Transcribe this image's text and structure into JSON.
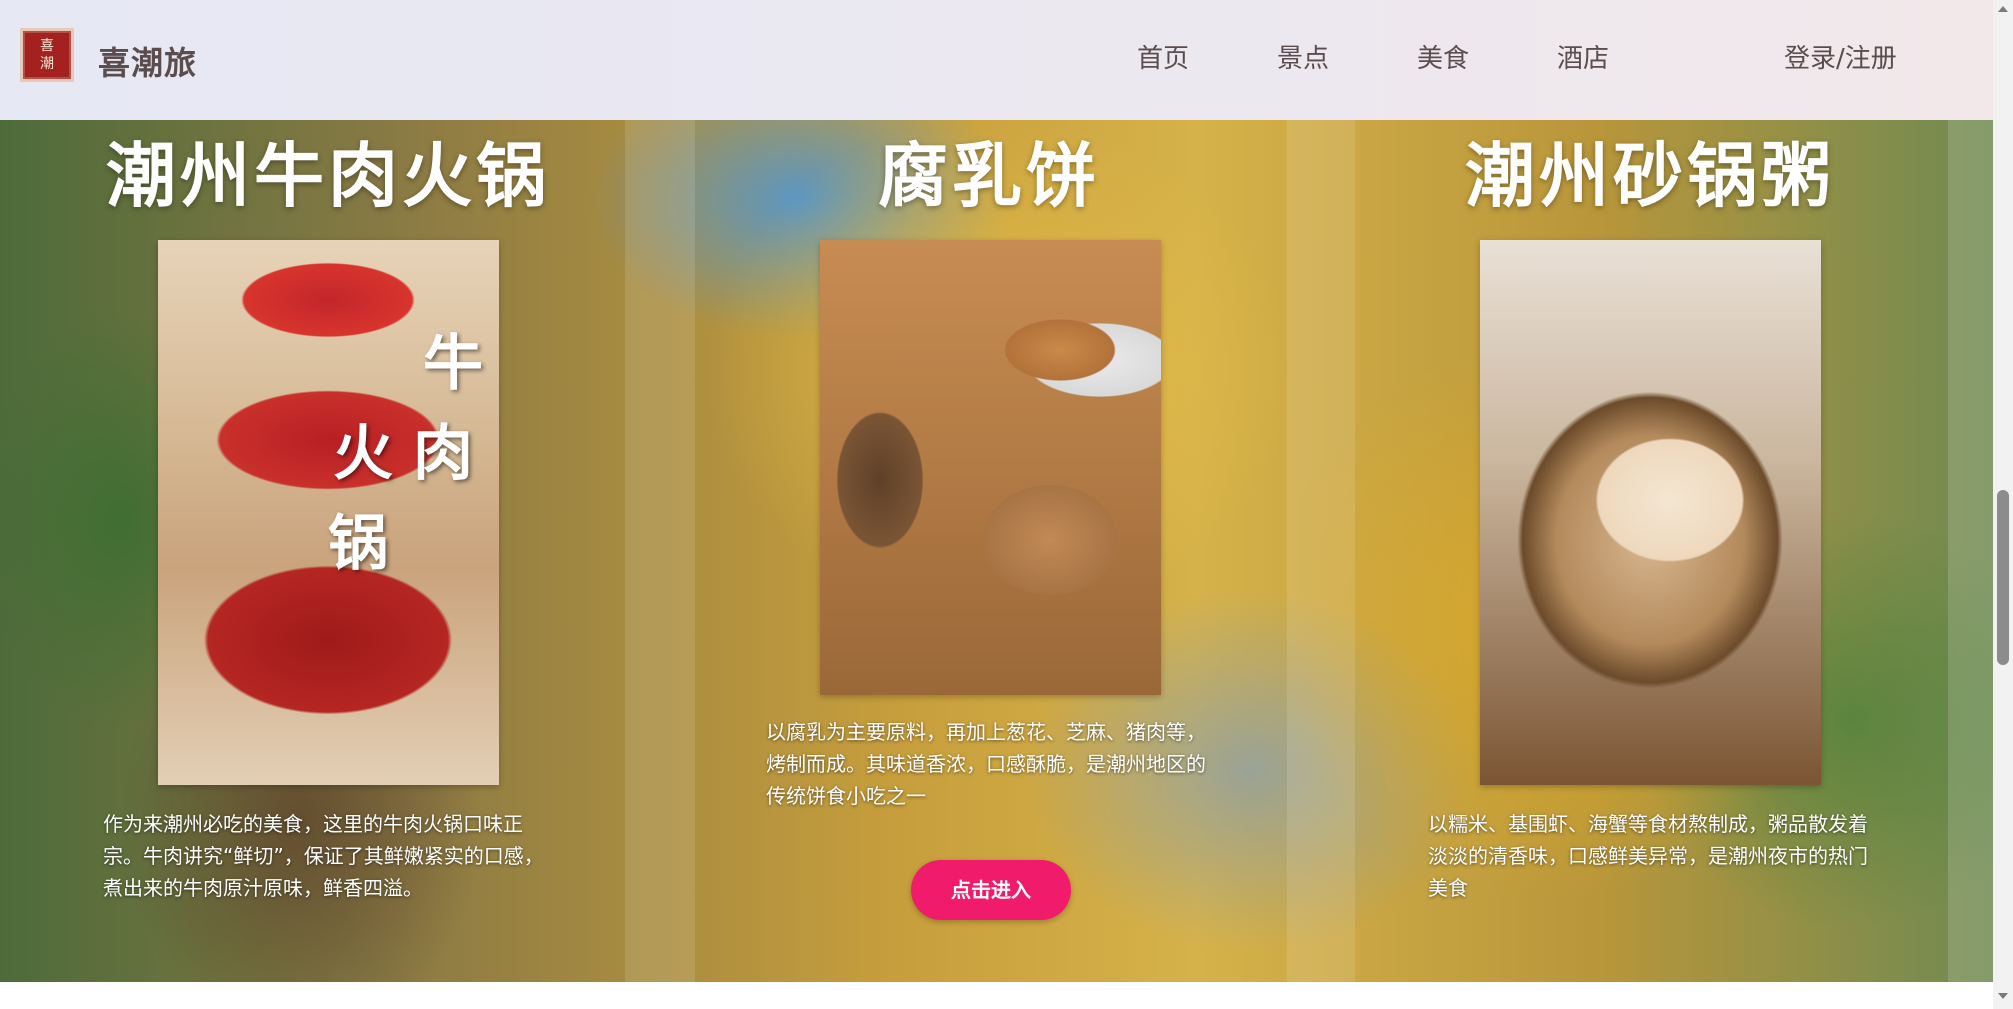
{
  "header": {
    "logo_chars": [
      "喜",
      "潮"
    ],
    "brand": "喜潮旅",
    "nav": {
      "home": "首页",
      "spots": "景点",
      "food": "美食",
      "hotel": "酒店"
    },
    "login": "登录/注册"
  },
  "cards": [
    {
      "title": "潮州牛肉火锅",
      "image_overlay": [
        "牛",
        "肉",
        "火",
        "锅"
      ],
      "description": "作为来潮州必吃的美食，这里的牛肉火锅口味正宗。牛肉讲究“鲜切”，保证了其鲜嫩紧实的口感，煮出来的牛肉原汁原味，鲜香四溢。"
    },
    {
      "title": "腐乳饼",
      "description": "以腐乳为主要原料，再加上葱花、芝麻、猪肉等，烤制而成。其味道香浓，口感酥脆，是潮州地区的传统饼食小吃之一",
      "button": "点击进入"
    },
    {
      "title": "潮州砂锅粥",
      "description": "以糯米、基围虾、海蟹等食材熬制成，粥品散发着淡淡的清香味，口感鲜美异常，是潮州夜市的热门美食"
    }
  ],
  "colors": {
    "button": "#f01b6b",
    "header_text": "#5b4d4e"
  }
}
